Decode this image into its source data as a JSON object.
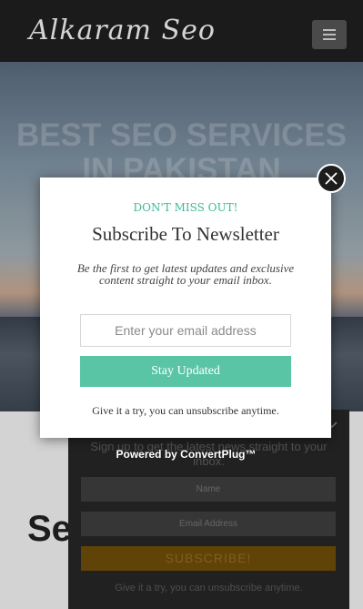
{
  "header": {
    "logo": "Alkaram Seo",
    "menu_icon": "hamburger-icon"
  },
  "hero": {
    "title_line1": "BEST SEO SERVICES",
    "title_line2": "IN PAKISTAN"
  },
  "section": {
    "heading_partial": "Se"
  },
  "slidein": {
    "close_icon": "chevron-down-icon",
    "text": "Sign up to get the latest news straight to your inbox.",
    "name_placeholder": "Name",
    "email_placeholder": "Email Address",
    "button_label": "SUBSCRIBE!",
    "footer_text": "Give it a try, you can unsubscribe anytime.",
    "button_color": "#6e4d07"
  },
  "modal": {
    "close_icon": "close-icon",
    "eyebrow": "DON'T MISS OUT!",
    "title": "Subscribe To Newsletter",
    "description": "Be the first to get latest updates and exclusive content straight to your email inbox.",
    "email_placeholder": "Enter your email address",
    "button_label": "Stay Updated",
    "footer_text": "Give it a try, you can unsubscribe anytime.",
    "accent_color": "#5ac5a5"
  },
  "powered_by": "Powered by ConvertPlug™"
}
